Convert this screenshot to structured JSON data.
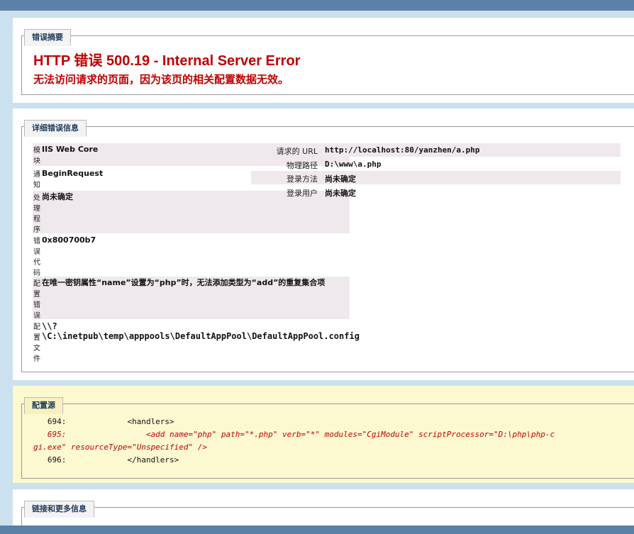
{
  "summary": {
    "legend": "错误摘要",
    "title": "HTTP 错误 500.19 - Internal Server Error",
    "subtitle": "无法访问请求的页面，因为该页的相关配置数据无效。"
  },
  "details": {
    "legend": "详细错误信息",
    "left": [
      {
        "label": "模块",
        "value": "IIS Web Core"
      },
      {
        "label": "通知",
        "value": "BeginRequest"
      },
      {
        "label": "处理程序",
        "value": "尚未确定"
      },
      {
        "label": "错误代码",
        "value": "0x800700b7"
      },
      {
        "label": "配置错误",
        "value": "在唯一密钥属性“name”设置为“php”时，无法添加类型为“add”的重复集合项"
      },
      {
        "label": "配置文件",
        "value": "\\\\?\\C:\\inetpub\\temp\\apppools\\DefaultAppPool\\DefaultAppPool.config"
      }
    ],
    "right": [
      {
        "label": "请求的 URL",
        "value": "http://localhost:80/yanzhen/a.php"
      },
      {
        "label": "物理路径",
        "value": "D:\\www\\a.php"
      },
      {
        "label": "登录方法",
        "value": "尚未确定"
      },
      {
        "label": "登录用户",
        "value": "尚未确定"
      }
    ]
  },
  "config_source": {
    "legend": "配置源",
    "line1": "   694:             <handlers>",
    "line2": "   695:                 <add name=\"php\" path=\"*.php\" verb=\"*\" modules=\"CgiModule\" scriptProcessor=\"D:\\php\\php-c",
    "line3": "gi.exe\" resourceType=\"Unspecified\" />",
    "line4": "   696:             </handlers>"
  },
  "links": {
    "legend": "链接和更多信息"
  },
  "colors": {
    "error_red": "#c00000",
    "frame_blue": "#5c81a7",
    "background": "#cbe1ef",
    "shaded_row": "#efe8ed",
    "config_bg": "#fcf8d0"
  }
}
